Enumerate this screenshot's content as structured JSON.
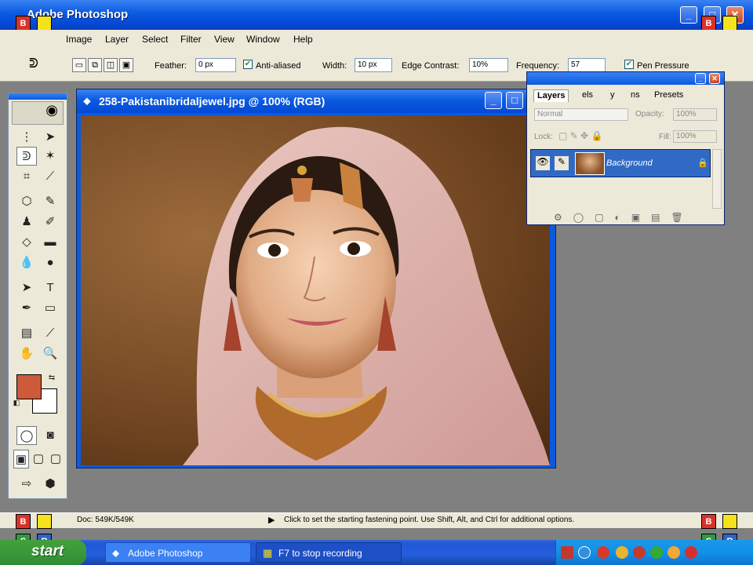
{
  "window": {
    "title": "Adobe Photoshop"
  },
  "menu": [
    "Image",
    "Layer",
    "Select",
    "Filter",
    "View",
    "Window",
    "Help"
  ],
  "options": {
    "feather_label": "Feather:",
    "feather_value": "0 px",
    "antialiased_label": "Anti-aliased",
    "antialiased_checked": true,
    "width_label": "Width:",
    "width_value": "10 px",
    "edge_contrast_label": "Edge Contrast:",
    "edge_contrast_value": "10%",
    "frequency_label": "Frequency:",
    "frequency_value": "57",
    "pen_pressure_label": "Pen Pressure",
    "pen_pressure_checked": true
  },
  "document": {
    "title": "258-Pakistanibridaljewel.jpg @ 100% (RGB)"
  },
  "layers_palette": {
    "tabs": [
      "Layers",
      "Channels",
      "History",
      "Actions",
      "Presets"
    ],
    "tab_visible": [
      "Layers",
      "els",
      "y",
      "ns",
      "Presets"
    ],
    "blend_mode": "Normal",
    "opacity_label": "Opacity:",
    "opacity_value": "100%",
    "lock_label": "Lock:",
    "fill_label": "Fill:",
    "fill_value": "100%",
    "layer_name": "Background"
  },
  "colors": {
    "foreground": "#cd5a3b",
    "background": "#ffffff"
  },
  "status": {
    "doc_size": "Doc: 549K/549K",
    "hint": "Click to set the starting fastening point. Use Shift, Alt, and Ctrl for additional options."
  },
  "recorder_badges": {
    "b": "B",
    "s": "S",
    "r": "R"
  },
  "taskbar": {
    "start_label": "start",
    "task1": "Adobe Photoshop",
    "task2": "F7 to stop recording"
  }
}
